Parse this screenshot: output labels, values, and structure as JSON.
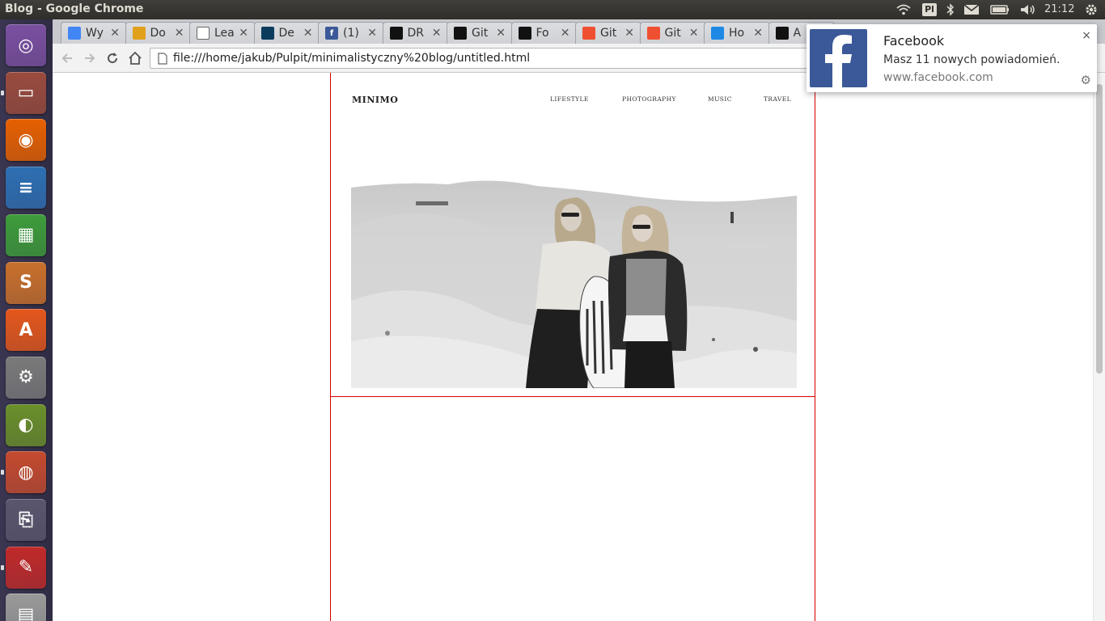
{
  "window": {
    "title": "Blog - Google Chrome"
  },
  "panel": {
    "keyboard_layout": "Pl",
    "clock": "21:12"
  },
  "launcher": {
    "items": [
      {
        "name": "ubuntu-dash",
        "color": "#7a4fa0"
      },
      {
        "name": "files",
        "color": "#9a4b3d"
      },
      {
        "name": "firefox",
        "color": "#e66000"
      },
      {
        "name": "libreoffice-writer",
        "color": "#2d6fb3"
      },
      {
        "name": "libreoffice-calc",
        "color": "#3d9c3a"
      },
      {
        "name": "sublime-text",
        "color": "#c9702b"
      },
      {
        "name": "software-center",
        "color": "#e4571c"
      },
      {
        "name": "system-settings",
        "color": "#7a7a7a"
      },
      {
        "name": "nvidia-settings",
        "color": "#6a8f2a"
      },
      {
        "name": "chrome",
        "color": "#c44a2f"
      },
      {
        "name": "usb-drive",
        "color": "#59566e"
      },
      {
        "name": "document-viewer",
        "color": "#c02a2a"
      },
      {
        "name": "scanner",
        "color": "#9a9a9a"
      }
    ]
  },
  "tabs": [
    {
      "title": "Wy",
      "favicon": "#4285f4",
      "icon": "chrome-web-store-icon"
    },
    {
      "title": "Do",
      "favicon": "#e2a11b",
      "icon": "search-icon"
    },
    {
      "title": "Lea",
      "favicon": "#ffffff",
      "icon": "code-icon"
    },
    {
      "title": "De",
      "favicon": "#0b3c5d",
      "icon": "d-icon"
    },
    {
      "title": "(1)",
      "favicon": "#3b5998",
      "icon": "facebook-icon"
    },
    {
      "title": "DR",
      "favicon": "#111111",
      "icon": "github-icon"
    },
    {
      "title": "Git",
      "favicon": "#111111",
      "icon": "gitter-icon"
    },
    {
      "title": "Fo",
      "favicon": "#111111",
      "icon": "github-icon"
    },
    {
      "title": "Git",
      "favicon": "#f05032",
      "icon": "git-icon"
    },
    {
      "title": "Git",
      "favicon": "#f05032",
      "icon": "git-icon"
    },
    {
      "title": "Ho",
      "favicon": "#1e88e5",
      "icon": "loading-icon"
    },
    {
      "title": "A",
      "favicon": "#111111",
      "icon": "github-icon"
    }
  ],
  "toolbar": {
    "url": "file:///home/jakub/Pulpit/minimalistyczny%20blog/untitled.html"
  },
  "blog": {
    "logo": "MINIMO",
    "nav": [
      "LIFESTYLE",
      "PHOTOGRAPHY",
      "MUSIC",
      "TRAVEL"
    ]
  },
  "notification": {
    "title": "Facebook",
    "message": "Masz 11 nowych powiadomień.",
    "source": "www.facebook.com",
    "close": "×",
    "settings": "⚙"
  }
}
